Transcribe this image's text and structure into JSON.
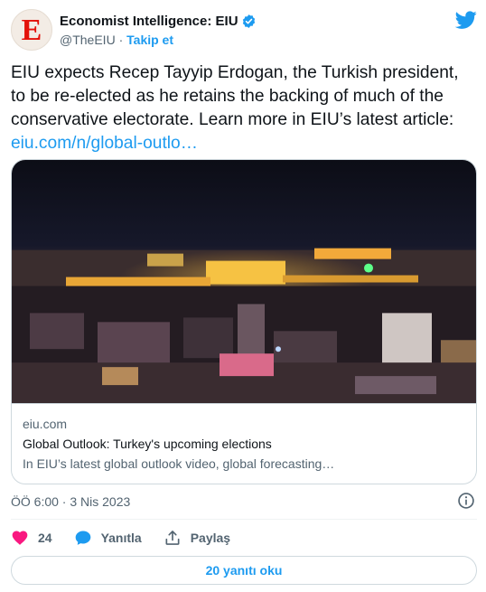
{
  "author": {
    "display_name": "Economist Intelligence: EIU",
    "handle": "@TheEIU",
    "separator": "·",
    "follow_label": "Takip et",
    "avatar_letter": "E",
    "brand_color": "#e3120b"
  },
  "tweet": {
    "text": "EIU expects Recep Tayyip Erdogan, the Turkish president, to be re-elected as he retains the backing of much of the conservative electorate. Learn more in EIU’s latest article:",
    "link": "eiu.com/n/global-outlo…"
  },
  "card": {
    "domain": "eiu.com",
    "title": "Global Outlook: Turkey's upcoming elections",
    "description": "In EIU’s latest global outlook video, global forecasting…",
    "image_subject": "night-city-skyline"
  },
  "meta": {
    "timestamp": "ÖÖ 6:00 · 3 Nis 2023"
  },
  "actions": {
    "like_count": "24",
    "reply_label": "Yanıtla",
    "share_label": "Paylaş"
  },
  "read_replies_label": "20 yanıtı oku",
  "colors": {
    "accent": "#1d9bf0",
    "like": "#f91880",
    "muted": "#536471"
  },
  "icons": [
    "verified-badge-icon",
    "twitter-bird-icon",
    "info-icon",
    "heart-icon",
    "reply-bubble-icon",
    "share-icon"
  ]
}
